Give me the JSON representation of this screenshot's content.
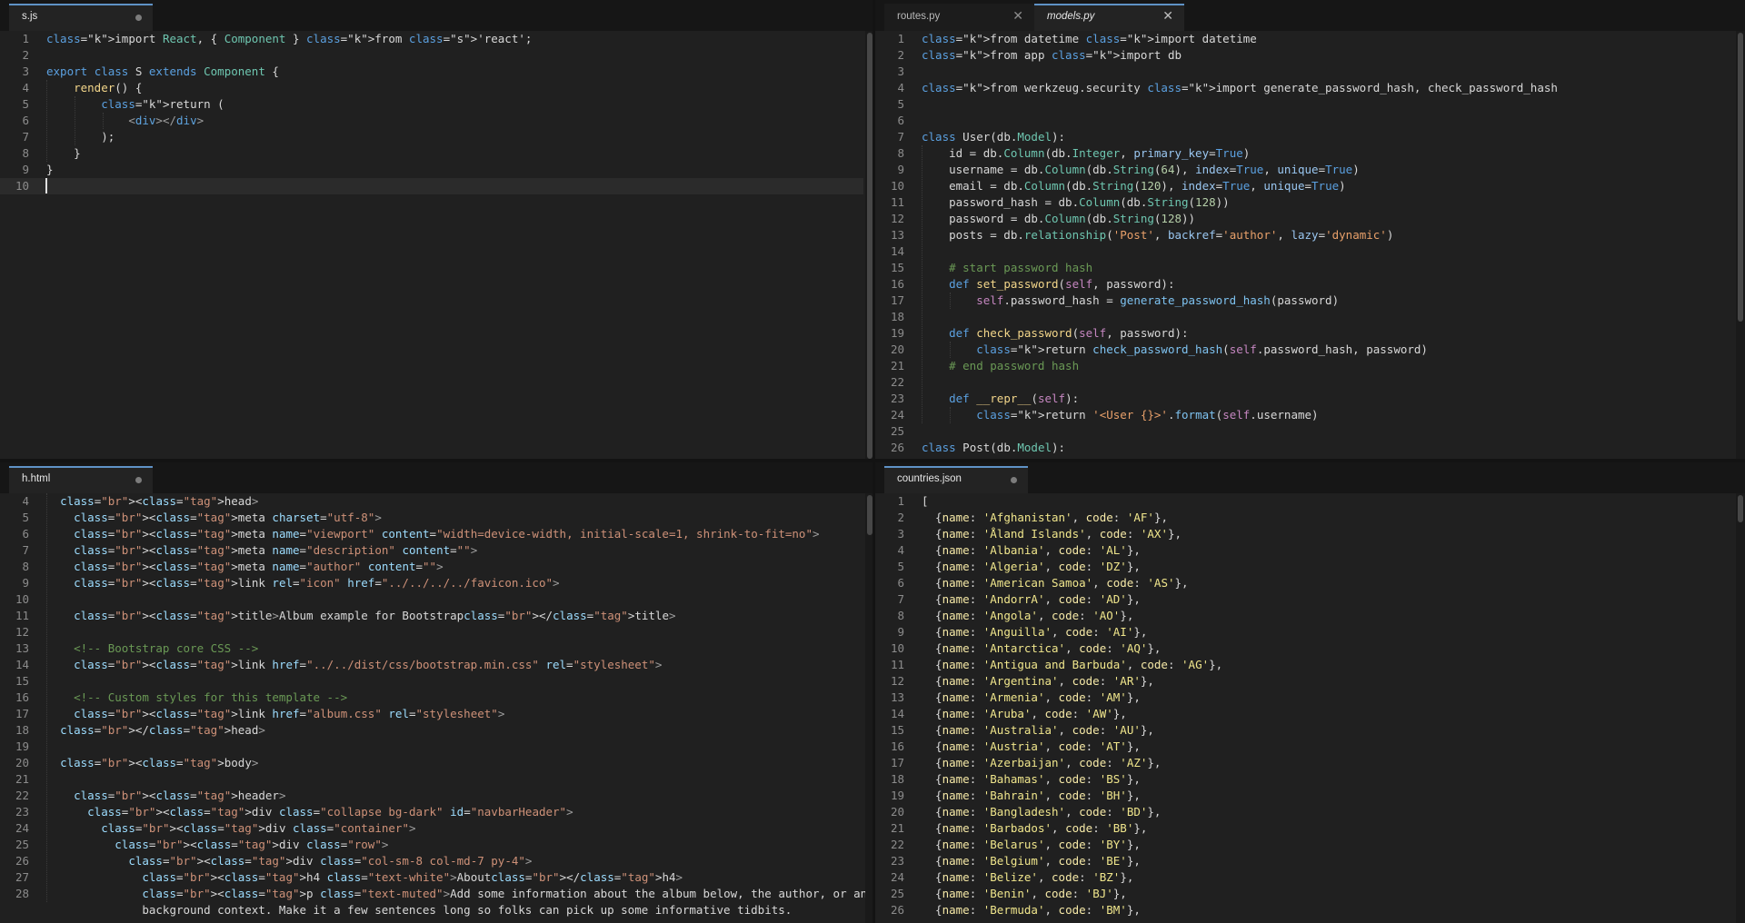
{
  "panes": {
    "top_left": {
      "tabs": [
        {
          "label": "s.js",
          "active": true,
          "dirty": true
        }
      ],
      "lines": [
        {
          "n": "1",
          "t": "import React, { Component } from 'react';"
        },
        {
          "n": "2",
          "t": ""
        },
        {
          "n": "3",
          "t": "export class S extends Component {"
        },
        {
          "n": "4",
          "t": "    render() {"
        },
        {
          "n": "5",
          "t": "        return ("
        },
        {
          "n": "6",
          "t": "            <div></div>"
        },
        {
          "n": "7",
          "t": "        );"
        },
        {
          "n": "8",
          "t": "    }"
        },
        {
          "n": "9",
          "t": "}"
        },
        {
          "n": "10",
          "t": ""
        }
      ]
    },
    "top_right": {
      "tabs": [
        {
          "label": "routes.py",
          "active": false
        },
        {
          "label": "models.py",
          "active": true
        }
      ],
      "lines": [
        {
          "n": "1",
          "t": "from datetime import datetime"
        },
        {
          "n": "2",
          "t": "from app import db"
        },
        {
          "n": "3",
          "t": ""
        },
        {
          "n": "4",
          "t": "from werkzeug.security import generate_password_hash, check_password_hash"
        },
        {
          "n": "5",
          "t": ""
        },
        {
          "n": "6",
          "t": ""
        },
        {
          "n": "7",
          "t": "class User(db.Model):"
        },
        {
          "n": "8",
          "t": "    id = db.Column(db.Integer, primary_key=True)"
        },
        {
          "n": "9",
          "t": "    username = db.Column(db.String(64), index=True, unique=True)"
        },
        {
          "n": "10",
          "t": "    email = db.Column(db.String(120), index=True, unique=True)"
        },
        {
          "n": "11",
          "t": "    password_hash = db.Column(db.String(128))"
        },
        {
          "n": "12",
          "t": "    password = db.Column(db.String(128))"
        },
        {
          "n": "13",
          "t": "    posts = db.relationship('Post', backref='author', lazy='dynamic')"
        },
        {
          "n": "14",
          "t": ""
        },
        {
          "n": "15",
          "t": "    # start password hash"
        },
        {
          "n": "16",
          "t": "    def set_password(self, password):"
        },
        {
          "n": "17",
          "t": "        self.password_hash = generate_password_hash(password)"
        },
        {
          "n": "18",
          "t": ""
        },
        {
          "n": "19",
          "t": "    def check_password(self, password):"
        },
        {
          "n": "20",
          "t": "        return check_password_hash(self.password_hash, password)"
        },
        {
          "n": "21",
          "t": "    # end password hash"
        },
        {
          "n": "22",
          "t": ""
        },
        {
          "n": "23",
          "t": "    def __repr__(self):"
        },
        {
          "n": "24",
          "t": "        return '<User {}>'.format(self.username)"
        },
        {
          "n": "25",
          "t": ""
        },
        {
          "n": "26",
          "t": "class Post(db.Model):"
        }
      ]
    },
    "bottom_left": {
      "tabs": [
        {
          "label": "h.html",
          "active": true,
          "dirty": true
        }
      ],
      "lines": [
        {
          "n": "4",
          "t": "  <head>"
        },
        {
          "n": "5",
          "t": "    <meta charset=\"utf-8\">"
        },
        {
          "n": "6",
          "t": "    <meta name=\"viewport\" content=\"width=device-width, initial-scale=1, shrink-to-fit=no\">"
        },
        {
          "n": "7",
          "t": "    <meta name=\"description\" content=\"\">"
        },
        {
          "n": "8",
          "t": "    <meta name=\"author\" content=\"\">"
        },
        {
          "n": "9",
          "t": "    <link rel=\"icon\" href=\"../../../../favicon.ico\">"
        },
        {
          "n": "10",
          "t": ""
        },
        {
          "n": "11",
          "t": "    <title>Album example for Bootstrap</title>"
        },
        {
          "n": "12",
          "t": ""
        },
        {
          "n": "13",
          "t": "    <!-- Bootstrap core CSS -->"
        },
        {
          "n": "14",
          "t": "    <link href=\"../../dist/css/bootstrap.min.css\" rel=\"stylesheet\">"
        },
        {
          "n": "15",
          "t": ""
        },
        {
          "n": "16",
          "t": "    <!-- Custom styles for this template -->"
        },
        {
          "n": "17",
          "t": "    <link href=\"album.css\" rel=\"stylesheet\">"
        },
        {
          "n": "18",
          "t": "  </head>"
        },
        {
          "n": "19",
          "t": ""
        },
        {
          "n": "20",
          "t": "  <body>"
        },
        {
          "n": "21",
          "t": ""
        },
        {
          "n": "22",
          "t": "    <header>"
        },
        {
          "n": "23",
          "t": "      <div class=\"collapse bg-dark\" id=\"navbarHeader\">"
        },
        {
          "n": "24",
          "t": "        <div class=\"container\">"
        },
        {
          "n": "25",
          "t": "          <div class=\"row\">"
        },
        {
          "n": "26",
          "t": "            <div class=\"col-sm-8 col-md-7 py-4\">"
        },
        {
          "n": "27",
          "t": "              <h4 class=\"text-white\">About</h4>"
        },
        {
          "n": "28",
          "t": "              <p class=\"text-muted\">Add some information about the album below, the author, or any other"
        },
        {
          "n": "",
          "t": "              background context. Make it a few sentences long so folks can pick up some informative tidbits."
        }
      ]
    },
    "bottom_right": {
      "tabs": [
        {
          "label": "countries.json",
          "active": true,
          "dirty": true
        }
      ],
      "lines": [
        {
          "n": "1",
          "t": "["
        },
        {
          "n": "2",
          "t": "  {name: 'Afghanistan', code: 'AF'},"
        },
        {
          "n": "3",
          "t": "  {name: 'Åland Islands', code: 'AX'},"
        },
        {
          "n": "4",
          "t": "  {name: 'Albania', code: 'AL'},"
        },
        {
          "n": "5",
          "t": "  {name: 'Algeria', code: 'DZ'},"
        },
        {
          "n": "6",
          "t": "  {name: 'American Samoa', code: 'AS'},"
        },
        {
          "n": "7",
          "t": "  {name: 'AndorrA', code: 'AD'},"
        },
        {
          "n": "8",
          "t": "  {name: 'Angola', code: 'AO'},"
        },
        {
          "n": "9",
          "t": "  {name: 'Anguilla', code: 'AI'},"
        },
        {
          "n": "10",
          "t": "  {name: 'Antarctica', code: 'AQ'},"
        },
        {
          "n": "11",
          "t": "  {name: 'Antigua and Barbuda', code: 'AG'},"
        },
        {
          "n": "12",
          "t": "  {name: 'Argentina', code: 'AR'},"
        },
        {
          "n": "13",
          "t": "  {name: 'Armenia', code: 'AM'},"
        },
        {
          "n": "14",
          "t": "  {name: 'Aruba', code: 'AW'},"
        },
        {
          "n": "15",
          "t": "  {name: 'Australia', code: 'AU'},"
        },
        {
          "n": "16",
          "t": "  {name: 'Austria', code: 'AT'},"
        },
        {
          "n": "17",
          "t": "  {name: 'Azerbaijan', code: 'AZ'},"
        },
        {
          "n": "18",
          "t": "  {name: 'Bahamas', code: 'BS'},"
        },
        {
          "n": "19",
          "t": "  {name: 'Bahrain', code: 'BH'},"
        },
        {
          "n": "20",
          "t": "  {name: 'Bangladesh', code: 'BD'},"
        },
        {
          "n": "21",
          "t": "  {name: 'Barbados', code: 'BB'},"
        },
        {
          "n": "22",
          "t": "  {name: 'Belarus', code: 'BY'},"
        },
        {
          "n": "23",
          "t": "  {name: 'Belgium', code: 'BE'},"
        },
        {
          "n": "24",
          "t": "  {name: 'Belize', code: 'BZ'},"
        },
        {
          "n": "25",
          "t": "  {name: 'Benin', code: 'BJ'},"
        },
        {
          "n": "26",
          "t": "  {name: 'Bermuda', code: 'BM'},"
        }
      ]
    }
  }
}
